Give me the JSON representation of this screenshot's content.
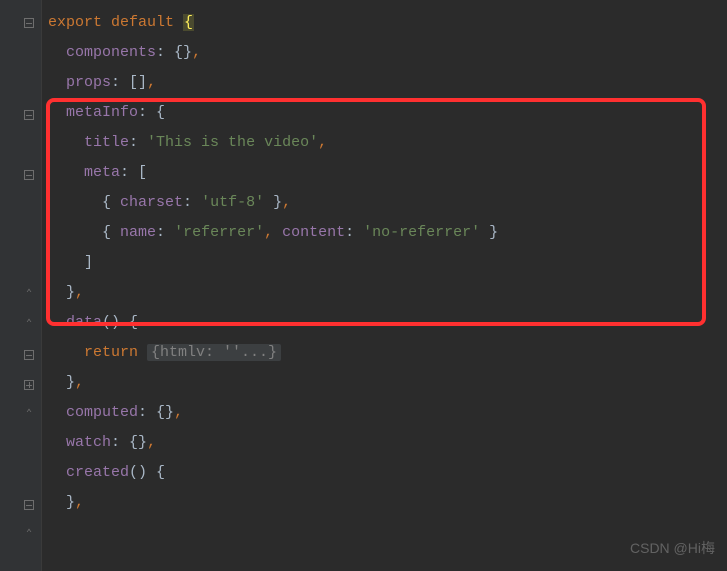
{
  "code": {
    "l1_export": "export",
    "l1_default": " default ",
    "l1_brace": "{",
    "l2_prop": "components",
    "l2_colon": ": ",
    "l2_val": "{}",
    "l2_comma": ",",
    "l3_prop": "props",
    "l3_colon": ": ",
    "l3_val": "[]",
    "l3_comma": ",",
    "l4_prop": "metaInfo",
    "l4_colon": ": ",
    "l4_brace": "{",
    "l5_prop": "title",
    "l5_colon": ": ",
    "l5_str": "'This is the video'",
    "l5_comma": ",",
    "l6_prop": "meta",
    "l6_colon": ": ",
    "l6_brace": "[",
    "l7_brace_o": "{ ",
    "l7_prop": "charset",
    "l7_colon": ": ",
    "l7_str": "'utf-8'",
    "l7_brace_c": " }",
    "l7_comma": ",",
    "l8_brace_o": "{ ",
    "l8_prop1": "name",
    "l8_colon1": ": ",
    "l8_str1": "'referrer'",
    "l8_comma1": ", ",
    "l8_prop2": "content",
    "l8_colon2": ": ",
    "l8_str2": "'no-referrer'",
    "l8_brace_c": " }",
    "l9_brace": "]",
    "l10_brace": "}",
    "l10_comma": ",",
    "l11_fn": "data",
    "l11_paren": "() ",
    "l11_brace": "{",
    "l12_return": "return ",
    "l12_folded": "{htmlv: ''...}",
    "l13_brace": "}",
    "l13_comma": ",",
    "l14_prop": "computed",
    "l14_colon": ": ",
    "l14_val": "{}",
    "l14_comma": ",",
    "l15_prop": "watch",
    "l15_colon": ": ",
    "l15_val": "{}",
    "l15_comma": ",",
    "l16_fn": "created",
    "l16_paren": "() ",
    "l16_brace": "{",
    "l17_brace": "}",
    "l17_comma": ","
  },
  "watermark": "CSDN @Hi梅"
}
